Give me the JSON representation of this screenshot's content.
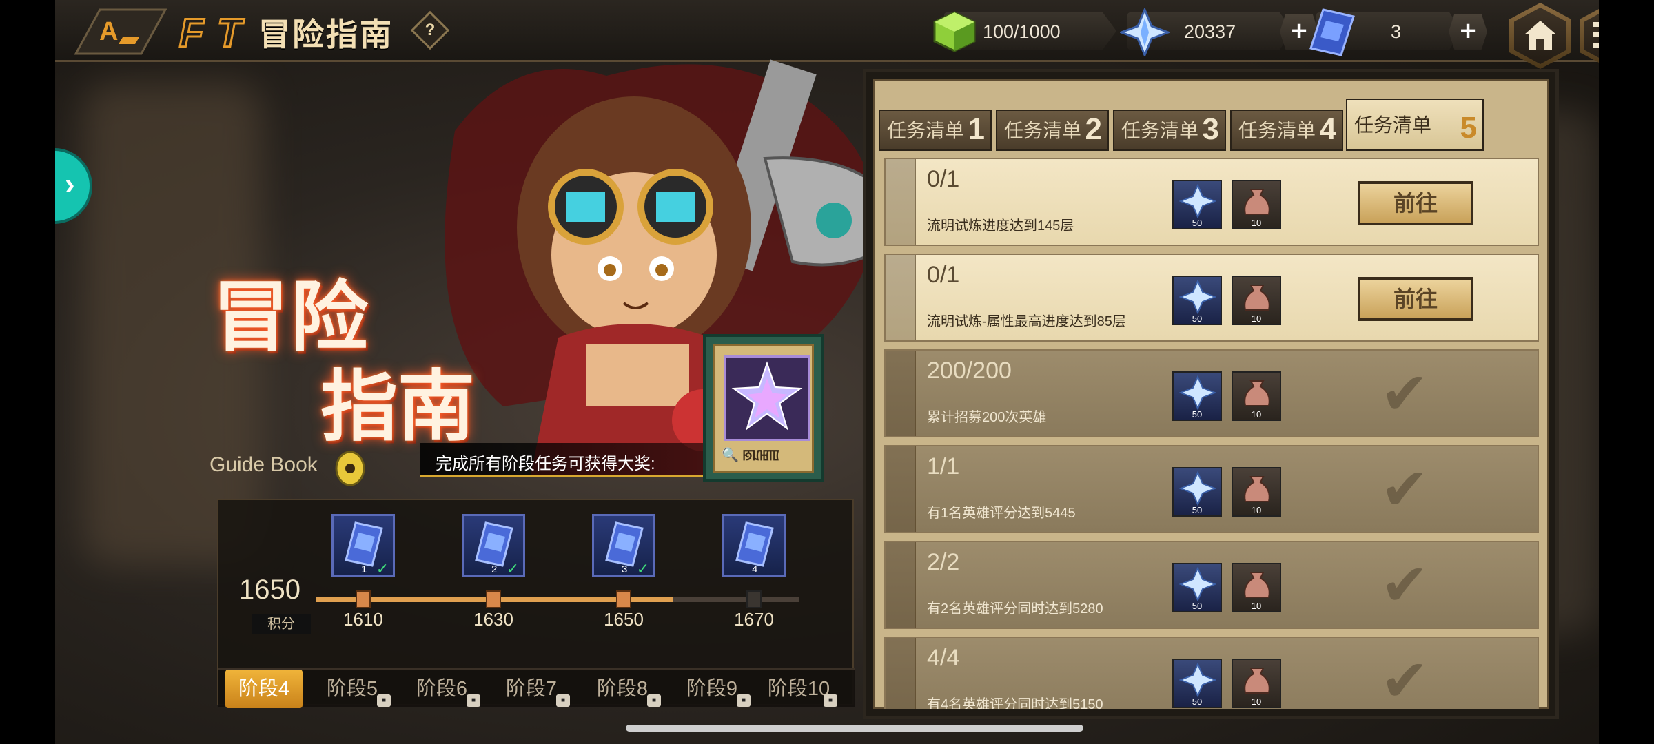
{
  "header": {
    "title": "冒险指南",
    "help_label": "?",
    "stamina": "100/1000",
    "gems": "20337",
    "tickets": "3",
    "plus_label": "+"
  },
  "hero": {
    "title_line1": "冒险",
    "title_line2": "指南",
    "subtitle": "Guide Book",
    "reward_text": "完成所有阶段任务可获得大奖:",
    "reward_box_label": "🔍 ꡐꡊꡅꡄ"
  },
  "progress": {
    "score": "1650",
    "score_label": "积分",
    "fill_fraction": 0.74,
    "milestones": [
      {
        "value": "1610",
        "ticket_num": "1",
        "done": "✓"
      },
      {
        "value": "1630",
        "ticket_num": "2",
        "done": "✓"
      },
      {
        "value": "1650",
        "ticket_num": "3",
        "done": "✓"
      },
      {
        "value": "1670",
        "ticket_num": "4",
        "done": ""
      }
    ]
  },
  "stage_tabs": [
    "阶段4",
    "阶段5",
    "阶段6",
    "阶段7",
    "阶段8",
    "阶段9",
    "阶段10"
  ],
  "task_tabs": [
    {
      "label": "任务清单",
      "num": "1"
    },
    {
      "label": "任务清单",
      "num": "2"
    },
    {
      "label": "任务清单",
      "num": "3"
    },
    {
      "label": "任务清单",
      "num": "4"
    },
    {
      "label": "任务清单",
      "num": "5"
    }
  ],
  "tasks": [
    {
      "progress": "0/1",
      "desc": "流明试炼进度达到145层",
      "gem_qty": "50",
      "bag_qty": "10",
      "action": "前往",
      "state": "open"
    },
    {
      "progress": "0/1",
      "desc": "流明试炼-属性最高进度达到85层",
      "gem_qty": "50",
      "bag_qty": "10",
      "action": "前往",
      "state": "open"
    },
    {
      "progress": "200/200",
      "desc": "累计招募200次英雄",
      "gem_qty": "50",
      "bag_qty": "10",
      "action": "",
      "state": "done"
    },
    {
      "progress": "1/1",
      "desc": "有1名英雄评分达到5445",
      "gem_qty": "50",
      "bag_qty": "10",
      "action": "",
      "state": "done"
    },
    {
      "progress": "2/2",
      "desc": "有2名英雄评分同时达到5280",
      "gem_qty": "50",
      "bag_qty": "10",
      "action": "",
      "state": "done"
    },
    {
      "progress": "4/4",
      "desc": "有4名英雄评分同时达到5150",
      "gem_qty": "50",
      "bag_qty": "10",
      "action": "",
      "state": "done"
    }
  ],
  "colors": {
    "accent": "#e0a050",
    "teal": "#15c4b0",
    "panel": "#c9b58a"
  }
}
